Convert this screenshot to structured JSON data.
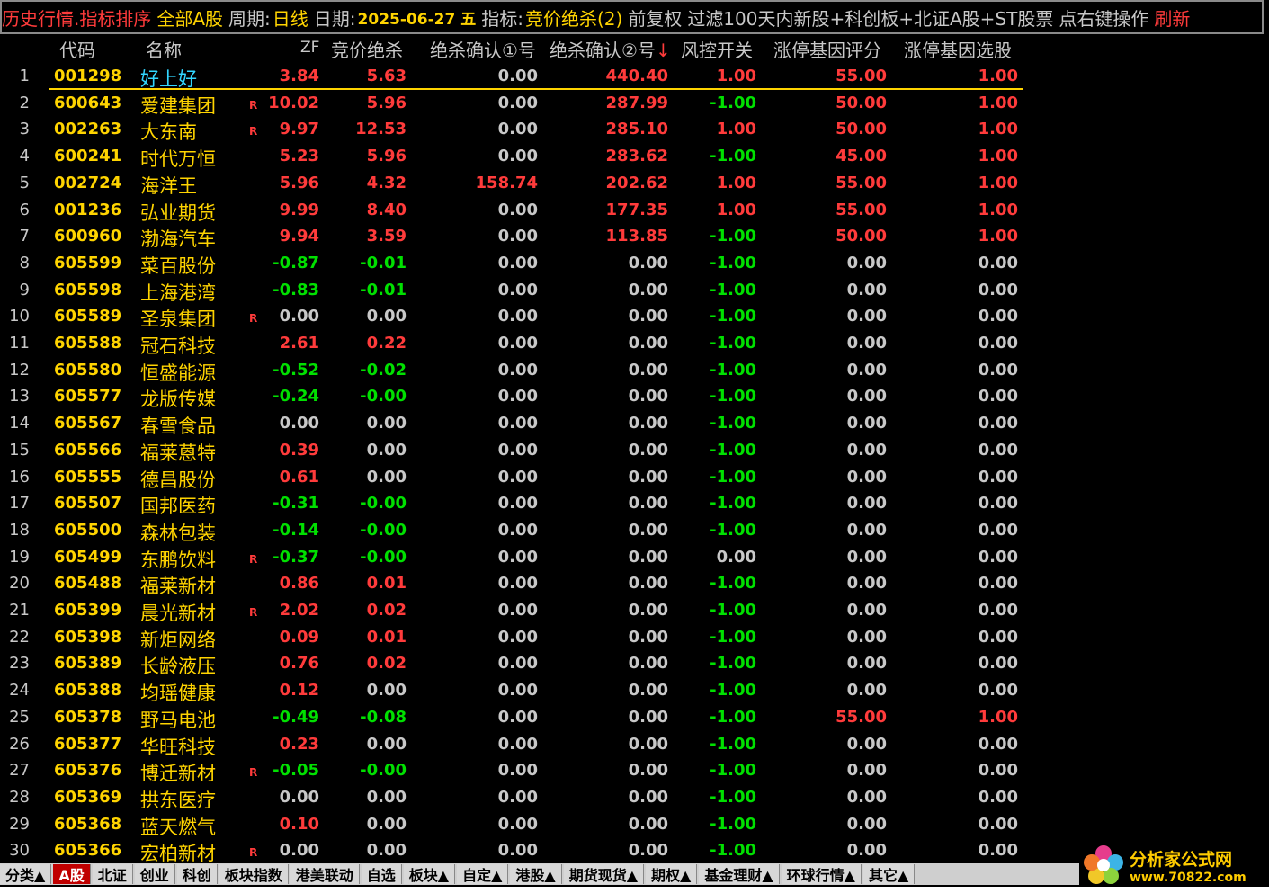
{
  "topbar": {
    "title": "历史行情.指标排序",
    "market": "全部A股",
    "period_label": "周期:",
    "period_value": "日线",
    "date_label": "日期:",
    "date_value": "2025-06-27 五",
    "indicator_label": "指标:",
    "indicator_value": "竞价绝杀(2)",
    "adjust": "前复权",
    "filter": "过滤100天内新股+科创板+北证A股+ST股票",
    "hint": "点右键操作",
    "refresh": "刷新"
  },
  "columns": {
    "code": "代码",
    "name": "名称",
    "zf": "ZF",
    "jingjia": "竞价绝杀",
    "confirm1": "绝杀确认①号",
    "confirm2": "绝杀确认②号",
    "sort_arrow": "↓",
    "risk": "风控开关",
    "score": "涨停基因评分",
    "pick": "涨停基因选股"
  },
  "rows": [
    {
      "i": "1",
      "code": "001298",
      "name": "好上好",
      "mark": "",
      "zf": "3.84",
      "jj": "5.63",
      "c1": "0.00",
      "c2": "440.40",
      "risk": "1.00",
      "score": "55.00",
      "pick": "1.00"
    },
    {
      "i": "2",
      "code": "600643",
      "name": "爱建集团",
      "mark": "R",
      "zf": "10.02",
      "jj": "5.96",
      "c1": "0.00",
      "c2": "287.99",
      "risk": "-1.00",
      "score": "50.00",
      "pick": "1.00"
    },
    {
      "i": "3",
      "code": "002263",
      "name": "大东南",
      "mark": "R",
      "zf": "9.97",
      "jj": "12.53",
      "c1": "0.00",
      "c2": "285.10",
      "risk": "1.00",
      "score": "50.00",
      "pick": "1.00"
    },
    {
      "i": "4",
      "code": "600241",
      "name": "时代万恒",
      "mark": "",
      "zf": "5.23",
      "jj": "5.96",
      "c1": "0.00",
      "c2": "283.62",
      "risk": "-1.00",
      "score": "45.00",
      "pick": "1.00"
    },
    {
      "i": "5",
      "code": "002724",
      "name": "海洋王",
      "mark": "",
      "zf": "5.96",
      "jj": "4.32",
      "c1": "158.74",
      "c2": "202.62",
      "risk": "1.00",
      "score": "55.00",
      "pick": "1.00"
    },
    {
      "i": "6",
      "code": "001236",
      "name": "弘业期货",
      "mark": "",
      "zf": "9.99",
      "jj": "8.40",
      "c1": "0.00",
      "c2": "177.35",
      "risk": "1.00",
      "score": "55.00",
      "pick": "1.00"
    },
    {
      "i": "7",
      "code": "600960",
      "name": "渤海汽车",
      "mark": "",
      "zf": "9.94",
      "jj": "3.59",
      "c1": "0.00",
      "c2": "113.85",
      "risk": "-1.00",
      "score": "50.00",
      "pick": "1.00"
    },
    {
      "i": "8",
      "code": "605599",
      "name": "菜百股份",
      "mark": "",
      "zf": "-0.87",
      "jj": "-0.01",
      "c1": "0.00",
      "c2": "0.00",
      "risk": "-1.00",
      "score": "0.00",
      "pick": "0.00"
    },
    {
      "i": "9",
      "code": "605598",
      "name": "上海港湾",
      "mark": "",
      "zf": "-0.83",
      "jj": "-0.01",
      "c1": "0.00",
      "c2": "0.00",
      "risk": "-1.00",
      "score": "0.00",
      "pick": "0.00"
    },
    {
      "i": "10",
      "code": "605589",
      "name": "圣泉集团",
      "mark": "R",
      "zf": "0.00",
      "jj": "0.00",
      "c1": "0.00",
      "c2": "0.00",
      "risk": "-1.00",
      "score": "0.00",
      "pick": "0.00"
    },
    {
      "i": "11",
      "code": "605588",
      "name": "冠石科技",
      "mark": "",
      "zf": "2.61",
      "jj": "0.22",
      "c1": "0.00",
      "c2": "0.00",
      "risk": "-1.00",
      "score": "0.00",
      "pick": "0.00"
    },
    {
      "i": "12",
      "code": "605580",
      "name": "恒盛能源",
      "mark": "",
      "zf": "-0.52",
      "jj": "-0.02",
      "c1": "0.00",
      "c2": "0.00",
      "risk": "-1.00",
      "score": "0.00",
      "pick": "0.00"
    },
    {
      "i": "13",
      "code": "605577",
      "name": "龙版传媒",
      "mark": "",
      "zf": "-0.24",
      "jj": "-0.00",
      "c1": "0.00",
      "c2": "0.00",
      "risk": "-1.00",
      "score": "0.00",
      "pick": "0.00"
    },
    {
      "i": "14",
      "code": "605567",
      "name": "春雪食品",
      "mark": "",
      "zf": "0.00",
      "jj": "0.00",
      "c1": "0.00",
      "c2": "0.00",
      "risk": "-1.00",
      "score": "0.00",
      "pick": "0.00"
    },
    {
      "i": "15",
      "code": "605566",
      "name": "福莱蒽特",
      "mark": "",
      "zf": "0.39",
      "jj": "0.00",
      "c1": "0.00",
      "c2": "0.00",
      "risk": "-1.00",
      "score": "0.00",
      "pick": "0.00"
    },
    {
      "i": "16",
      "code": "605555",
      "name": "德昌股份",
      "mark": "",
      "zf": "0.61",
      "jj": "0.00",
      "c1": "0.00",
      "c2": "0.00",
      "risk": "-1.00",
      "score": "0.00",
      "pick": "0.00"
    },
    {
      "i": "17",
      "code": "605507",
      "name": "国邦医药",
      "mark": "",
      "zf": "-0.31",
      "jj": "-0.00",
      "c1": "0.00",
      "c2": "0.00",
      "risk": "-1.00",
      "score": "0.00",
      "pick": "0.00"
    },
    {
      "i": "18",
      "code": "605500",
      "name": "森林包装",
      "mark": "",
      "zf": "-0.14",
      "jj": "-0.00",
      "c1": "0.00",
      "c2": "0.00",
      "risk": "-1.00",
      "score": "0.00",
      "pick": "0.00"
    },
    {
      "i": "19",
      "code": "605499",
      "name": "东鹏饮料",
      "mark": "R",
      "zf": "-0.37",
      "jj": "-0.00",
      "c1": "0.00",
      "c2": "0.00",
      "risk": "0.00",
      "score": "0.00",
      "pick": "0.00"
    },
    {
      "i": "20",
      "code": "605488",
      "name": "福莱新材",
      "mark": "",
      "zf": "0.86",
      "jj": "0.01",
      "c1": "0.00",
      "c2": "0.00",
      "risk": "-1.00",
      "score": "0.00",
      "pick": "0.00"
    },
    {
      "i": "21",
      "code": "605399",
      "name": "晨光新材",
      "mark": "R",
      "zf": "2.02",
      "jj": "0.02",
      "c1": "0.00",
      "c2": "0.00",
      "risk": "-1.00",
      "score": "0.00",
      "pick": "0.00"
    },
    {
      "i": "22",
      "code": "605398",
      "name": "新炬网络",
      "mark": "",
      "zf": "0.09",
      "jj": "0.01",
      "c1": "0.00",
      "c2": "0.00",
      "risk": "-1.00",
      "score": "0.00",
      "pick": "0.00"
    },
    {
      "i": "23",
      "code": "605389",
      "name": "长龄液压",
      "mark": "",
      "zf": "0.76",
      "jj": "0.02",
      "c1": "0.00",
      "c2": "0.00",
      "risk": "-1.00",
      "score": "0.00",
      "pick": "0.00"
    },
    {
      "i": "24",
      "code": "605388",
      "name": "均瑶健康",
      "mark": "",
      "zf": "0.12",
      "jj": "0.00",
      "c1": "0.00",
      "c2": "0.00",
      "risk": "-1.00",
      "score": "0.00",
      "pick": "0.00"
    },
    {
      "i": "25",
      "code": "605378",
      "name": "野马电池",
      "mark": "",
      "zf": "-0.49",
      "jj": "-0.08",
      "c1": "0.00",
      "c2": "0.00",
      "risk": "-1.00",
      "score": "55.00",
      "pick": "1.00"
    },
    {
      "i": "26",
      "code": "605377",
      "name": "华旺科技",
      "mark": "",
      "zf": "0.23",
      "jj": "0.00",
      "c1": "0.00",
      "c2": "0.00",
      "risk": "-1.00",
      "score": "0.00",
      "pick": "0.00"
    },
    {
      "i": "27",
      "code": "605376",
      "name": "博迁新材",
      "mark": "R",
      "zf": "-0.05",
      "jj": "-0.00",
      "c1": "0.00",
      "c2": "0.00",
      "risk": "-1.00",
      "score": "0.00",
      "pick": "0.00"
    },
    {
      "i": "28",
      "code": "605369",
      "name": "拱东医疗",
      "mark": "",
      "zf": "0.00",
      "jj": "0.00",
      "c1": "0.00",
      "c2": "0.00",
      "risk": "-1.00",
      "score": "0.00",
      "pick": "0.00"
    },
    {
      "i": "29",
      "code": "605368",
      "name": "蓝天燃气",
      "mark": "",
      "zf": "0.10",
      "jj": "0.00",
      "c1": "0.00",
      "c2": "0.00",
      "risk": "-1.00",
      "score": "0.00",
      "pick": "0.00"
    },
    {
      "i": "30",
      "code": "605366",
      "name": "宏柏新材",
      "mark": "R",
      "zf": "0.00",
      "jj": "0.00",
      "c1": "0.00",
      "c2": "0.00",
      "risk": "-1.00",
      "score": "0.00",
      "pick": "0.00"
    }
  ],
  "bottom_tabs": [
    {
      "label": "分类▲",
      "active": false
    },
    {
      "label": "A股",
      "active": true
    },
    {
      "label": "北证",
      "active": false
    },
    {
      "label": "创业",
      "active": false
    },
    {
      "label": "科创",
      "active": false
    },
    {
      "label": "板块指数",
      "active": false
    },
    {
      "label": "港美联动",
      "active": false
    },
    {
      "label": "自选",
      "active": false
    },
    {
      "label": "板块▲",
      "active": false
    },
    {
      "label": "自定▲",
      "active": false
    },
    {
      "label": "港股▲",
      "active": false
    },
    {
      "label": "期货现货▲",
      "active": false
    },
    {
      "label": "期权▲",
      "active": false
    },
    {
      "label": "基金理财▲",
      "active": false
    },
    {
      "label": "环球行情▲",
      "active": false
    },
    {
      "label": "其它▲",
      "active": false
    }
  ],
  "logo": {
    "cn": "分析家公式网",
    "url": "www.70822.com"
  },
  "colors": {
    "up": "#ff3b3b",
    "down": "#00e000",
    "neutral": "#c8c8c8",
    "code": "#ffd400",
    "accent_tab": "#c00000"
  }
}
